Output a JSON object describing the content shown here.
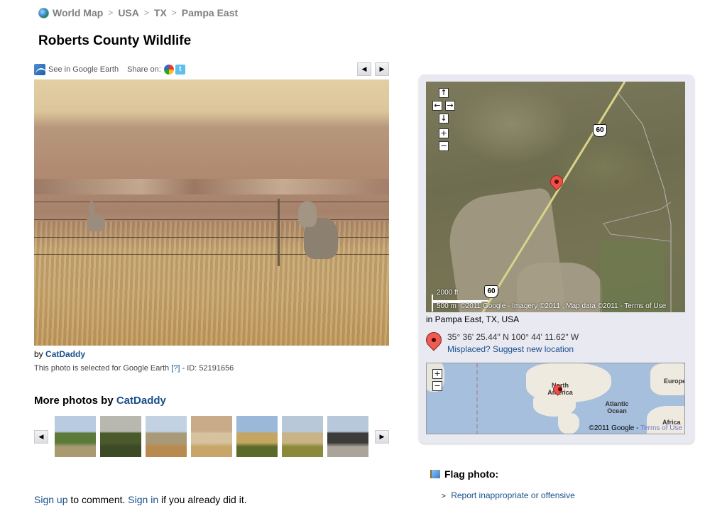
{
  "breadcrumb": {
    "icon": "globe-icon",
    "items": [
      "World Map",
      "USA",
      "TX",
      "Pampa East"
    ],
    "separator": ">"
  },
  "page_title": "Roberts County Wildlife",
  "photo_toolbar": {
    "google_earth_label": "See in Google Earth",
    "share_label": "Share on:",
    "share_services": [
      "Google Buzz",
      "Twitter"
    ],
    "prev_label": "◀",
    "next_label": "▶"
  },
  "photo": {
    "alt": "Two deer in tall dry grass behind a barbed wire fence on rolling prairie"
  },
  "byline": {
    "prefix": "by",
    "author": "CatDaddy"
  },
  "google_earth_note": {
    "text": "This photo is selected for Google Earth",
    "help_link": "[?]",
    "id_text": "- ID: 52191656"
  },
  "more_photos": {
    "title_prefix": "More photos by",
    "author": "CatDaddy",
    "prev_label": "◀",
    "next_label": "▶",
    "thumbnails": [
      {
        "desc": "bird over green field",
        "colors": [
          "#b9cbe0",
          "#5c7a3a",
          "#a99a72"
        ]
      },
      {
        "desc": "dark green hill",
        "colors": [
          "#b8b8b0",
          "#4a5a2a",
          "#3c4a26"
        ]
      },
      {
        "desc": "canyon grassland",
        "colors": [
          "#c2d2e2",
          "#a89a78",
          "#b88a50"
        ]
      },
      {
        "desc": "deer in dry grass",
        "colors": [
          "#c9ab8a",
          "#d6c29e",
          "#c8a66a"
        ]
      },
      {
        "desc": "tractor in wheat field",
        "colors": [
          "#9cb8d8",
          "#c4a662",
          "#5a6a2a"
        ]
      },
      {
        "desc": "combine harvesting",
        "colors": [
          "#b8c8d8",
          "#c8b486",
          "#8a8a3a"
        ]
      },
      {
        "desc": "windmill by pond",
        "colors": [
          "#b6c8da",
          "#3c3c3a",
          "#aaa49a"
        ]
      }
    ]
  },
  "comment": {
    "signup": "Sign up",
    "middle": "to comment.",
    "signin": "Sign in",
    "suffix": "if you already did it."
  },
  "map": {
    "controls": {
      "up": "↑",
      "left": "←",
      "right": "→",
      "down": "↓",
      "zoom_in": "+",
      "zoom_out": "−"
    },
    "highway_labels": [
      "60",
      "60"
    ],
    "scale_ft": "2000 ft",
    "scale_m": "500 m",
    "attribution": "©2011 Google - Imagery ©2011 , Map data ©2011 - Terms of Use"
  },
  "location": {
    "place": "in Pampa East, TX, USA",
    "coordinates": "35° 36' 25.44\" N  100° 44' 11.62\" W",
    "misplaced_link": "Misplaced? Suggest new location"
  },
  "overview_map": {
    "zoom_in": "+",
    "zoom_out": "−",
    "labels": {
      "north_america": "North America",
      "atlantic": "Atlantic Ocean",
      "europe": "Europe",
      "africa": "Africa"
    },
    "copyright": "©2011 Google -",
    "terms": "Terms of Use"
  },
  "flag": {
    "title": "Flag photo:",
    "report_link": "Report inappropriate or offensive"
  }
}
